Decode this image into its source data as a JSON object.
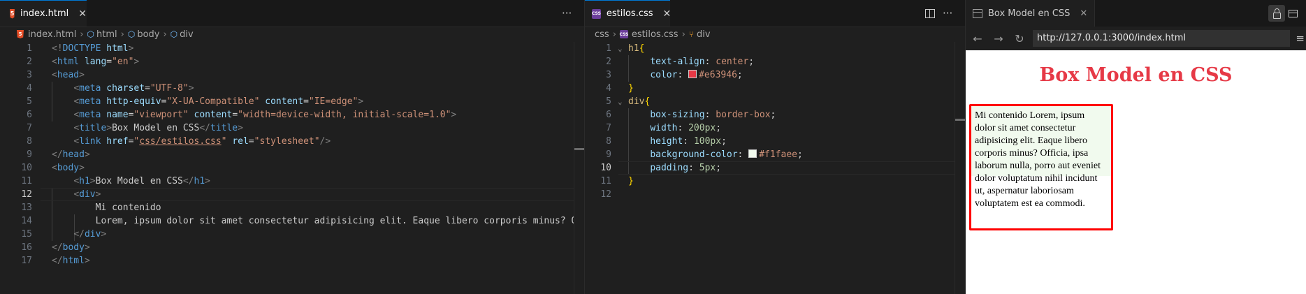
{
  "left_editor": {
    "tab": {
      "icon": "html5-icon",
      "label": "index.html",
      "close": "✕"
    },
    "actions": {
      "more": "···"
    },
    "breadcrumb": [
      "index.html",
      "html",
      "body",
      "div"
    ],
    "current_line": 12,
    "lines": [
      {
        "n": "1",
        "text": "<!DOCTYPE html>"
      },
      {
        "n": "2",
        "text": "<html lang=\"en\">"
      },
      {
        "n": "3",
        "text": "<head>"
      },
      {
        "n": "4",
        "text": "    <meta charset=\"UTF-8\">"
      },
      {
        "n": "5",
        "text": "    <meta http-equiv=\"X-UA-Compatible\" content=\"IE=edge\">"
      },
      {
        "n": "6",
        "text": "    <meta name=\"viewport\" content=\"width=device-width, initial-scale=1.0\">"
      },
      {
        "n": "7",
        "text": "    <title>Box Model en CSS</title>"
      },
      {
        "n": "8",
        "text": "    <link href=\"css/estilos.css\" rel=\"stylesheet\"/>"
      },
      {
        "n": "9",
        "text": "</head>"
      },
      {
        "n": "10",
        "text": "<body>"
      },
      {
        "n": "11",
        "text": "    <h1>Box Model en CSS</h1>"
      },
      {
        "n": "12",
        "text": "    <div>"
      },
      {
        "n": "13",
        "text": "        Mi contenido"
      },
      {
        "n": "14",
        "text": "        Lorem, ipsum dolor sit amet consectetur adipisicing elit. Eaque libero corporis minus? Offi"
      },
      {
        "n": "15",
        "text": "    </div>"
      },
      {
        "n": "16",
        "text": "</body>"
      },
      {
        "n": "17",
        "text": "</html>"
      }
    ]
  },
  "mid_editor": {
    "tab": {
      "icon": "css-icon",
      "label": "estilos.css",
      "close": "✕"
    },
    "actions": {
      "split": "split-editor-icon",
      "more": "···"
    },
    "breadcrumb": [
      "css",
      "estilos.css",
      "div"
    ],
    "current_line": 10,
    "lines": [
      {
        "n": "1",
        "text": "h1{"
      },
      {
        "n": "2",
        "text": "    text-align: center;"
      },
      {
        "n": "3",
        "text": "    color: #e63946;"
      },
      {
        "n": "4",
        "text": "}"
      },
      {
        "n": "5",
        "text": "div{"
      },
      {
        "n": "6",
        "text": "    box-sizing: border-box;"
      },
      {
        "n": "7",
        "text": "    width: 200px;"
      },
      {
        "n": "8",
        "text": "    height: 100px;"
      },
      {
        "n": "9",
        "text": "    background-color: #f1faee;"
      },
      {
        "n": "10",
        "text": "    padding: 5px;"
      },
      {
        "n": "11",
        "text": "}"
      },
      {
        "n": "12",
        "text": ""
      }
    ],
    "colors": {
      "h1": "#e63946",
      "div_bg": "#f1faee"
    }
  },
  "browser": {
    "tab_label": "Box Model en CSS",
    "tab_close": "✕",
    "url": "http://127.0.0.1:3000/index.html",
    "page": {
      "h1": "Box Model en CSS",
      "div_text": "Mi contenido Lorem, ipsum dolor sit amet consectetur adipisicing elit. Eaque libero corporis minus? Officia, ipsa laborum nulla, porro aut eveniet dolor voluptatum nihil incidunt ut, aspernatur laboriosam voluptatem est ea commodi."
    },
    "colors": {
      "h1": "#e63946",
      "focus": "#ff0000",
      "div_bg": "#f1faee"
    }
  }
}
